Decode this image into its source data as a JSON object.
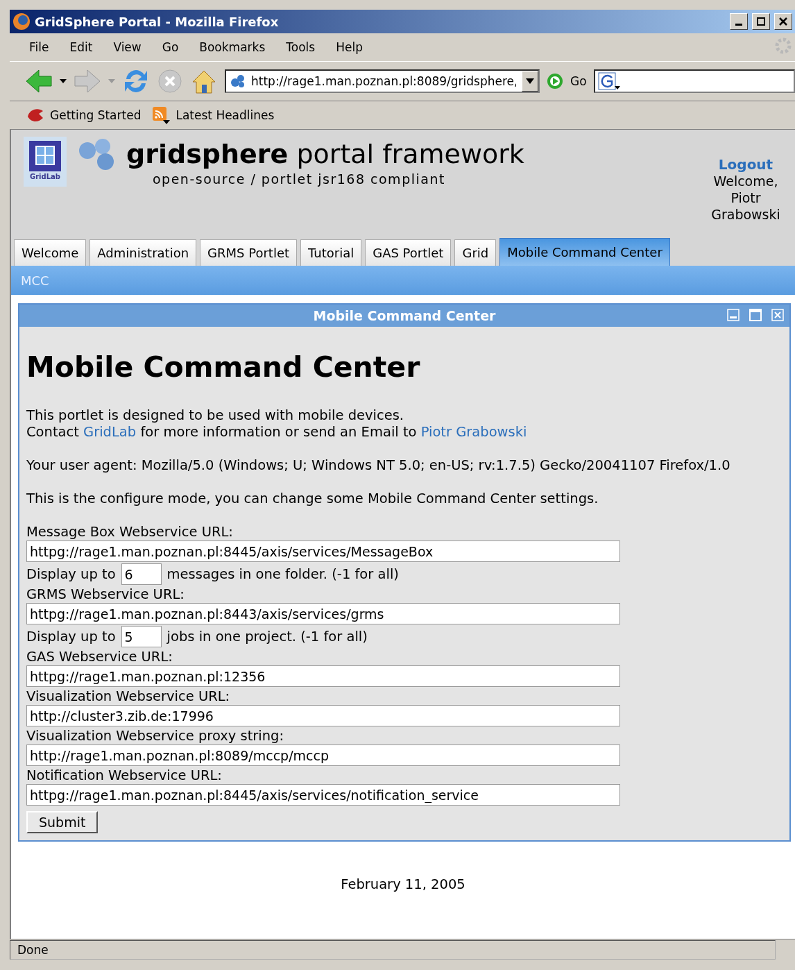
{
  "window": {
    "title": "GridSphere Portal - Mozilla Firefox"
  },
  "menu": [
    "File",
    "Edit",
    "View",
    "Go",
    "Bookmarks",
    "Tools",
    "Help"
  ],
  "toolbar": {
    "address": "http://rage1.man.poznan.pl:8089/gridsphere,",
    "go": "Go"
  },
  "bookmarks": [
    "Getting Started",
    "Latest Headlines"
  ],
  "header": {
    "logo_text": "GridLab",
    "title": "gridsphere",
    "title_rest": "portal framework",
    "subtitle": "open-source / portlet jsr168 compliant",
    "logout": "Logout",
    "welcome": "Welcome, Piotr Grabowski"
  },
  "tabs": [
    {
      "label": "Welcome",
      "selected": false
    },
    {
      "label": "Administration",
      "selected": false
    },
    {
      "label": "GRMS Portlet",
      "selected": false
    },
    {
      "label": "Tutorial",
      "selected": false
    },
    {
      "label": "GAS Portlet",
      "selected": false
    },
    {
      "label": "Grid",
      "selected": false
    },
    {
      "label": "Mobile Command Center",
      "selected": true
    }
  ],
  "subtabs": [
    {
      "label": "MCC"
    }
  ],
  "portlet": {
    "title": "Mobile Command Center",
    "heading": "Mobile Command Center",
    "intro": "This portlet is designed to be used with mobile devices.",
    "contact": {
      "before": "Contact ",
      "link1": "GridLab",
      "middle": " for more information or send an Email to ",
      "link2": "Piotr Grabowski"
    },
    "agent": "Your user agent: Mozilla/5.0 (Windows; U; Windows NT 5.0; en-US; rv:1.7.5) Gecko/20041107 Firefox/1.0",
    "mode": "This is the configure mode, you can change some Mobile Command Center settings.",
    "fields": [
      {
        "kind": "url",
        "label": "Message Box Webservice URL:",
        "value": "httpg://rage1.man.poznan.pl:8445/axis/services/MessageBox"
      },
      {
        "kind": "count",
        "before": "Display up to",
        "value": "6",
        "after": "messages in one folder. (-1 for all)"
      },
      {
        "kind": "url",
        "label": "GRMS Webservice URL:",
        "value": "httpg://rage1.man.poznan.pl:8443/axis/services/grms"
      },
      {
        "kind": "count",
        "before": "Display up to",
        "value": "5",
        "after": "jobs in one project. (-1 for all)"
      },
      {
        "kind": "url",
        "label": "GAS Webservice URL:",
        "value": "httpg://rage1.man.poznan.pl:12356"
      },
      {
        "kind": "url",
        "label": "Visualization Webservice URL:",
        "value": "http://cluster3.zib.de:17996"
      },
      {
        "kind": "url",
        "label": "Visualization Webservice proxy string:",
        "value": "http://rage1.man.poznan.pl:8089/mccp/mccp"
      },
      {
        "kind": "url",
        "label": "Notification Webservice URL:",
        "value": "httpg://rage1.man.poznan.pl:8445/axis/services/notification_service"
      }
    ],
    "submit": "Submit"
  },
  "footer": {
    "date": "February 11, 2005"
  },
  "status_bar": {
    "text": "Done"
  }
}
